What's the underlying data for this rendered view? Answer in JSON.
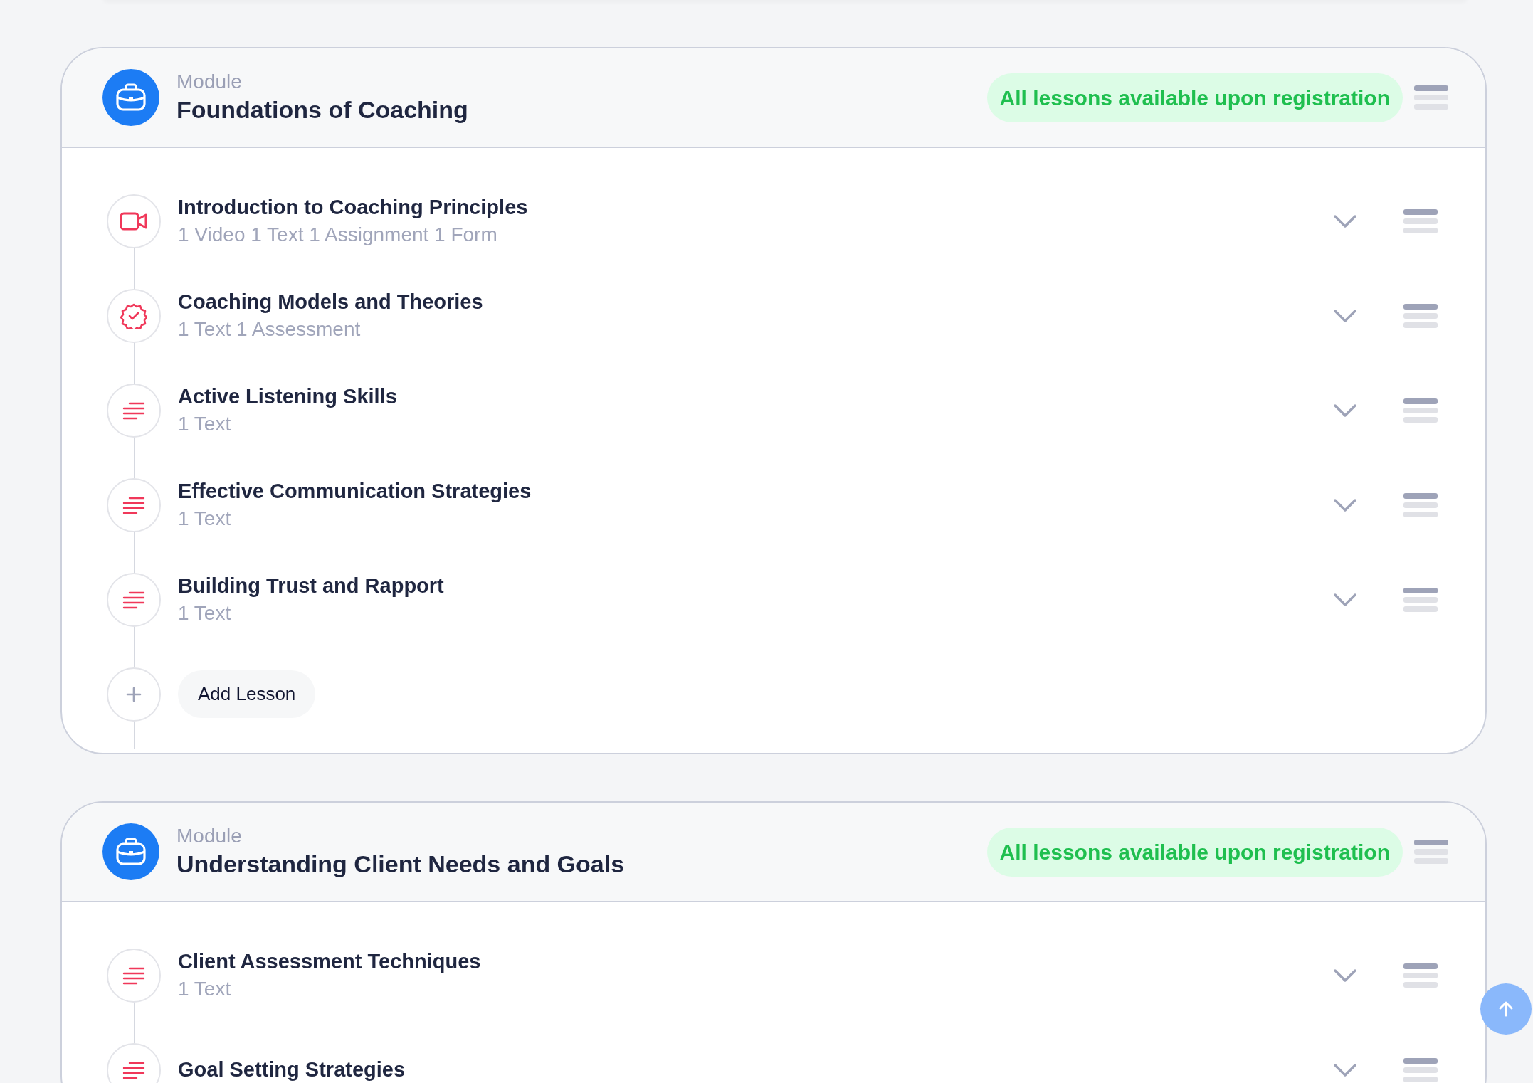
{
  "modules": [
    {
      "label": "Module",
      "title": "Foundations of Coaching",
      "badge": "All lessons available upon registration",
      "lessons": [
        {
          "kind": "video",
          "title": "Introduction to Coaching Principles",
          "summary": "1 Video 1 Text 1 Assignment 1 Form"
        },
        {
          "kind": "assessment",
          "title": "Coaching Models and Theories",
          "summary": "1 Text 1 Assessment"
        },
        {
          "kind": "text",
          "title": "Active Listening Skills",
          "summary": "1 Text"
        },
        {
          "kind": "text",
          "title": "Effective Communication Strategies",
          "summary": "1 Text"
        },
        {
          "kind": "text",
          "title": "Building Trust and Rapport",
          "summary": "1 Text"
        }
      ],
      "add_button": "Add Lesson"
    },
    {
      "label": "Module",
      "title": "Understanding Client Needs and Goals",
      "badge": "All lessons available upon registration",
      "lessons": [
        {
          "kind": "text",
          "title": "Client Assessment Techniques",
          "summary": "1 Text"
        },
        {
          "kind": "text",
          "title": "Goal Setting Strategies"
        }
      ]
    }
  ]
}
